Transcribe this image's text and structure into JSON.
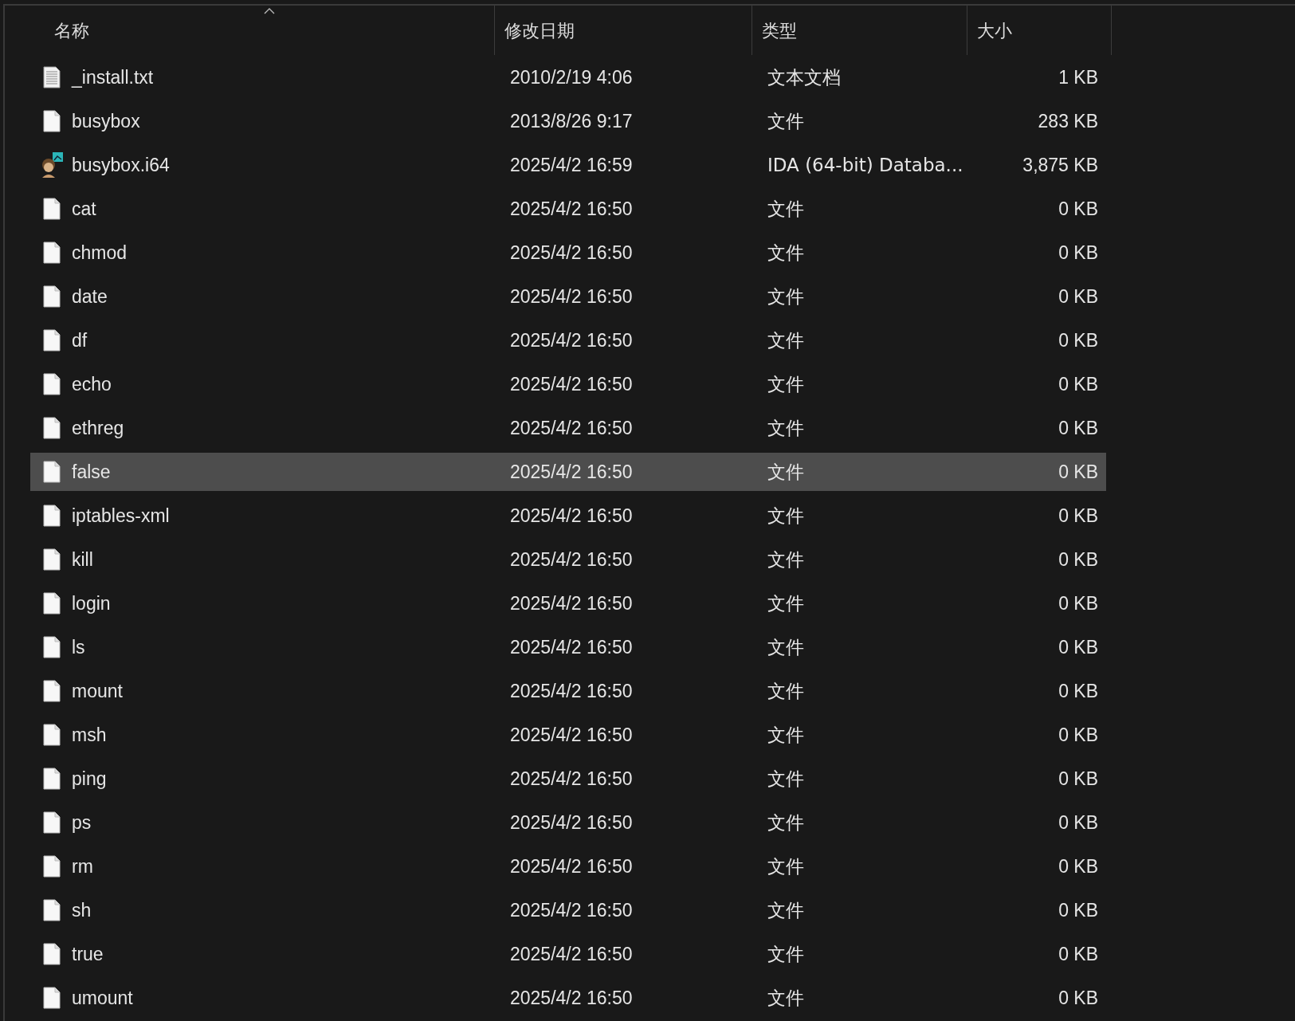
{
  "columns": [
    {
      "label": "名称",
      "sorted": true
    },
    {
      "label": "修改日期",
      "sorted": false
    },
    {
      "label": "类型",
      "sorted": false
    },
    {
      "label": "大小",
      "sorted": false
    }
  ],
  "rows": [
    {
      "name": "_install.txt",
      "date": "2010/2/19 4:06",
      "type": "文本文档",
      "size": "1 KB",
      "kind": "text",
      "selected": false
    },
    {
      "name": "busybox",
      "date": "2013/8/26 9:17",
      "type": "文件",
      "size": "283 KB",
      "kind": "file",
      "selected": false
    },
    {
      "name": "busybox.i64",
      "date": "2025/4/2 16:59",
      "type": "IDA (64-bit) Databa...",
      "size": "3,875 KB",
      "kind": "database",
      "selected": false
    },
    {
      "name": "cat",
      "date": "2025/4/2 16:50",
      "type": "文件",
      "size": "0 KB",
      "kind": "file",
      "selected": false
    },
    {
      "name": "chmod",
      "date": "2025/4/2 16:50",
      "type": "文件",
      "size": "0 KB",
      "kind": "file",
      "selected": false
    },
    {
      "name": "date",
      "date": "2025/4/2 16:50",
      "type": "文件",
      "size": "0 KB",
      "kind": "file",
      "selected": false
    },
    {
      "name": "df",
      "date": "2025/4/2 16:50",
      "type": "文件",
      "size": "0 KB",
      "kind": "file",
      "selected": false
    },
    {
      "name": "echo",
      "date": "2025/4/2 16:50",
      "type": "文件",
      "size": "0 KB",
      "kind": "file",
      "selected": false
    },
    {
      "name": "ethreg",
      "date": "2025/4/2 16:50",
      "type": "文件",
      "size": "0 KB",
      "kind": "file",
      "selected": false
    },
    {
      "name": "false",
      "date": "2025/4/2 16:50",
      "type": "文件",
      "size": "0 KB",
      "kind": "file",
      "selected": true
    },
    {
      "name": "iptables-xml",
      "date": "2025/4/2 16:50",
      "type": "文件",
      "size": "0 KB",
      "kind": "file",
      "selected": false
    },
    {
      "name": "kill",
      "date": "2025/4/2 16:50",
      "type": "文件",
      "size": "0 KB",
      "kind": "file",
      "selected": false
    },
    {
      "name": "login",
      "date": "2025/4/2 16:50",
      "type": "文件",
      "size": "0 KB",
      "kind": "file",
      "selected": false
    },
    {
      "name": "ls",
      "date": "2025/4/2 16:50",
      "type": "文件",
      "size": "0 KB",
      "kind": "file",
      "selected": false
    },
    {
      "name": "mount",
      "date": "2025/4/2 16:50",
      "type": "文件",
      "size": "0 KB",
      "kind": "file",
      "selected": false
    },
    {
      "name": "msh",
      "date": "2025/4/2 16:50",
      "type": "文件",
      "size": "0 KB",
      "kind": "file",
      "selected": false
    },
    {
      "name": "ping",
      "date": "2025/4/2 16:50",
      "type": "文件",
      "size": "0 KB",
      "kind": "file",
      "selected": false
    },
    {
      "name": "ps",
      "date": "2025/4/2 16:50",
      "type": "文件",
      "size": "0 KB",
      "kind": "file",
      "selected": false
    },
    {
      "name": "rm",
      "date": "2025/4/2 16:50",
      "type": "文件",
      "size": "0 KB",
      "kind": "file",
      "selected": false
    },
    {
      "name": "sh",
      "date": "2025/4/2 16:50",
      "type": "文件",
      "size": "0 KB",
      "kind": "file",
      "selected": false
    },
    {
      "name": "true",
      "date": "2025/4/2 16:50",
      "type": "文件",
      "size": "0 KB",
      "kind": "file",
      "selected": false
    },
    {
      "name": "umount",
      "date": "2025/4/2 16:50",
      "type": "文件",
      "size": "0 KB",
      "kind": "file",
      "selected": false
    }
  ]
}
